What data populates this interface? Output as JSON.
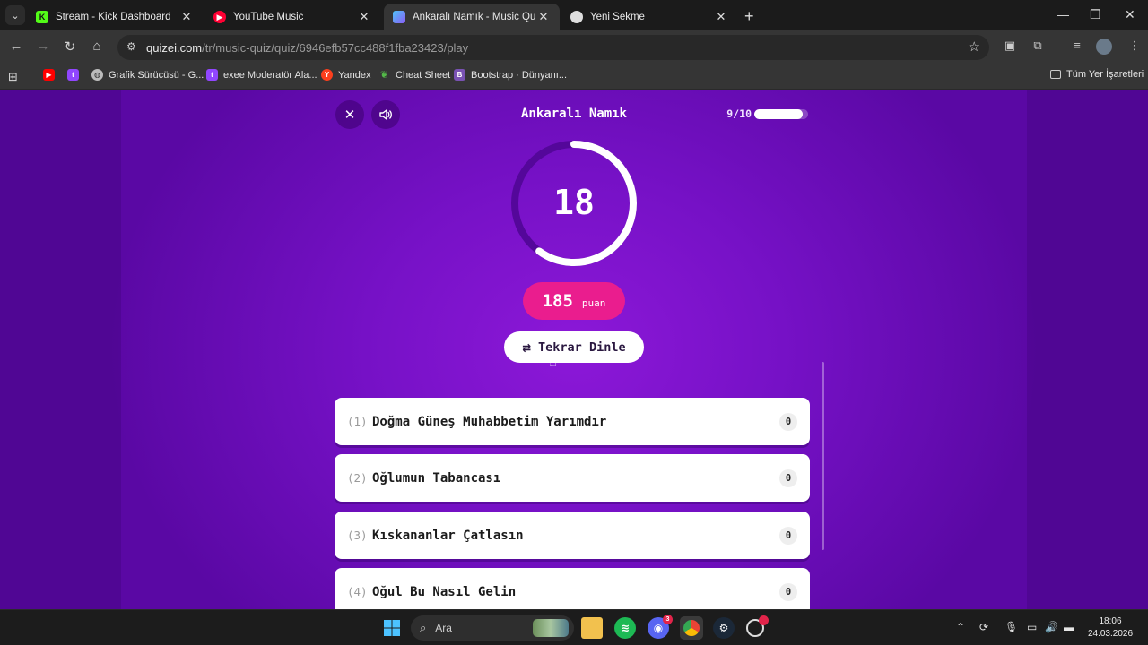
{
  "browser": {
    "tabs": [
      {
        "title": "Stream - Kick Dashboard",
        "favicon": "kick-icon",
        "color": "#53fc18",
        "active": false
      },
      {
        "title": "YouTube Music",
        "favicon": "youtube-music-icon",
        "color": "#ff0033",
        "active": false
      },
      {
        "title": "Ankaralı Namık - Music Quiz - C",
        "favicon": "quizei-icon",
        "color": "#8a5cf6",
        "active": true
      },
      {
        "title": "Yeni Sekme",
        "favicon": "chrome-icon",
        "color": "#dddddd",
        "active": false
      }
    ],
    "address": {
      "host": "quizei.com",
      "path": "/tr/music-quiz/quiz/6946efb57cc488f1fba23423/play"
    },
    "bookmarks": [
      {
        "label": "",
        "icon": "youtube-icon",
        "color": "#ff0000"
      },
      {
        "label": "",
        "icon": "twitch-icon",
        "color": "#9146ff"
      },
      {
        "label": "Grafik Sürücüsü - G...",
        "icon": "globe-icon",
        "color": "#bbbbbb"
      },
      {
        "label": "exee Moderatör Ala...",
        "icon": "twitch-icon",
        "color": "#9146ff"
      },
      {
        "label": "Yandex",
        "icon": "yandex-icon",
        "color": "#fc3f1d"
      },
      {
        "label": "Cheat Sheet",
        "icon": "leaf-icon",
        "color": "#53b948"
      },
      {
        "label": "Bootstrap · Dünyanı...",
        "icon": "bootstrap-icon",
        "color": "#7952b3"
      }
    ],
    "all_bookmarks": "Tüm Yer İşaretleri"
  },
  "quiz": {
    "title": "Ankaralı Namık",
    "progress_text": "9/10",
    "progress_fraction": 0.9,
    "timer": "18",
    "timer_fraction": 0.6,
    "score_value": "185",
    "score_unit": "puan",
    "replay_label": "Tekrar Dinle",
    "options": [
      {
        "index": "(1)",
        "label": "Doğma Güneş Muhabbetim Yarımdır",
        "count": "0"
      },
      {
        "index": "(2)",
        "label": "Oğlumun Tabancası",
        "count": "0"
      },
      {
        "index": "(3)",
        "label": "Kıskananlar Çatlasın",
        "count": "0"
      },
      {
        "index": "(4)",
        "label": "Oğul Bu Nasıl Gelin",
        "count": "0"
      }
    ],
    "colors": {
      "background": "#7611c6",
      "accent": "#ea1d8e",
      "timer_ring": "#ffffff"
    }
  },
  "taskbar": {
    "search_placeholder": "Ara",
    "discord_badge": "3",
    "time": "18:06",
    "date": "24.03.2026"
  }
}
